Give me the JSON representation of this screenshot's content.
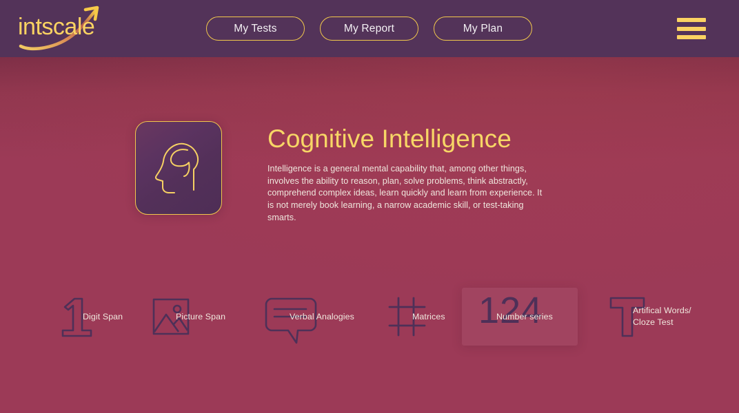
{
  "brand": {
    "name": "intscale",
    "logo_icon": "arrow-swoosh-icon",
    "colors": {
      "gold": "#f2c94c",
      "gold_light": "#fbd362",
      "header_purple": "#533359",
      "background_rose": "#9c3a57",
      "icon_purple": "#4e3058",
      "text_cream": "#f0e8de"
    }
  },
  "header": {
    "nav": [
      {
        "label": "My Tests"
      },
      {
        "label": "My Report"
      },
      {
        "label": "My Plan"
      }
    ],
    "menu_icon": "hamburger-menu-icon"
  },
  "hero": {
    "card_icon": "head-brain-icon",
    "title": "Cognitive Intelligence",
    "description": "Intelligence is a general mental capability that, among other things, involves the ability to reason, plan, solve problems, think abstractly, comprehend complex ideas, learn quickly and learn from experience. It is not merely book learning, a narrow academic skill, or test-taking smarts."
  },
  "tests": [
    {
      "label": "Digit Span",
      "icon": "numeral-one-icon"
    },
    {
      "label": "Picture Span",
      "icon": "image-picture-icon"
    },
    {
      "label": "Verbal Analogies",
      "icon": "speech-bubble-icon"
    },
    {
      "label": "Matrices",
      "icon": "grid-matrix-icon"
    },
    {
      "label": "Number series",
      "icon": "number-124-icon",
      "glyph_text": "124",
      "active": true
    },
    {
      "label": "Artifical Words/\nCloze Test",
      "icon": "letter-t-icon"
    }
  ]
}
